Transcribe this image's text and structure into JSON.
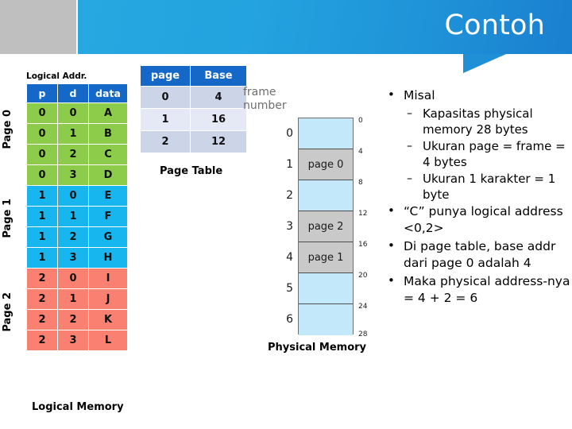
{
  "header": {
    "title": "Contoh"
  },
  "logical_memory": {
    "addr_label": "Logical Addr.",
    "caption": "Logical Memory",
    "columns": [
      "p",
      "d",
      "data"
    ],
    "side_labels": [
      "Page 0",
      "Page 1",
      "Page 2"
    ],
    "rows": [
      {
        "p": "0",
        "d": "0",
        "data": "A",
        "page": 0
      },
      {
        "p": "0",
        "d": "1",
        "data": "B",
        "page": 0
      },
      {
        "p": "0",
        "d": "2",
        "data": "C",
        "page": 0
      },
      {
        "p": "0",
        "d": "3",
        "data": "D",
        "page": 0
      },
      {
        "p": "1",
        "d": "0",
        "data": "E",
        "page": 1
      },
      {
        "p": "1",
        "d": "1",
        "data": "F",
        "page": 1
      },
      {
        "p": "1",
        "d": "2",
        "data": "G",
        "page": 1
      },
      {
        "p": "1",
        "d": "3",
        "data": "H",
        "page": 1
      },
      {
        "p": "2",
        "d": "0",
        "data": "I",
        "page": 2
      },
      {
        "p": "2",
        "d": "1",
        "data": "J",
        "page": 2
      },
      {
        "p": "2",
        "d": "2",
        "data": "K",
        "page": 2
      },
      {
        "p": "2",
        "d": "3",
        "data": "L",
        "page": 2
      }
    ],
    "colors": {
      "header": "#1568c8",
      "page0": "#8dcc4a",
      "page1": "#17b6ee",
      "page2": "#fa8072"
    }
  },
  "page_table": {
    "caption": "Page Table",
    "columns": [
      "page",
      "Base"
    ],
    "rows": [
      {
        "page": "0",
        "base": "4"
      },
      {
        "page": "1",
        "base": "16"
      },
      {
        "page": "2",
        "base": "12"
      }
    ],
    "colors": {
      "header": "#1568c8",
      "row_a": "#ccd4e7",
      "row_b": "#e5e9f5"
    }
  },
  "physical_memory": {
    "frame_number_label": "frame number",
    "caption": "Physical Memory",
    "frames": [
      {
        "index": "0",
        "content": "",
        "used": false
      },
      {
        "index": "1",
        "content": "page 0",
        "used": true
      },
      {
        "index": "2",
        "content": "",
        "used": false
      },
      {
        "index": "3",
        "content": "page 2",
        "used": true
      },
      {
        "index": "4",
        "content": "page 1",
        "used": true
      },
      {
        "index": "5",
        "content": "",
        "used": false
      },
      {
        "index": "6",
        "content": "",
        "used": false
      }
    ],
    "address_ticks": [
      "0",
      "4",
      "8",
      "12",
      "16",
      "20",
      "24",
      "28"
    ],
    "colors": {
      "free": "#c3e8fa",
      "used": "#c9c9c9"
    }
  },
  "notes": {
    "b1": "Misal",
    "b1s1": "Kapasitas physical memory 28 bytes",
    "b1s2": "Ukuran page = frame = 4 bytes",
    "b1s3": "Ukuran 1 karakter = 1 byte",
    "b2": "“C” punya logical address <0,2>",
    "b3": "Di page table, base addr dari page 0 adalah 4",
    "b4": "Maka physical address-nya = 4 + 2 = 6"
  }
}
